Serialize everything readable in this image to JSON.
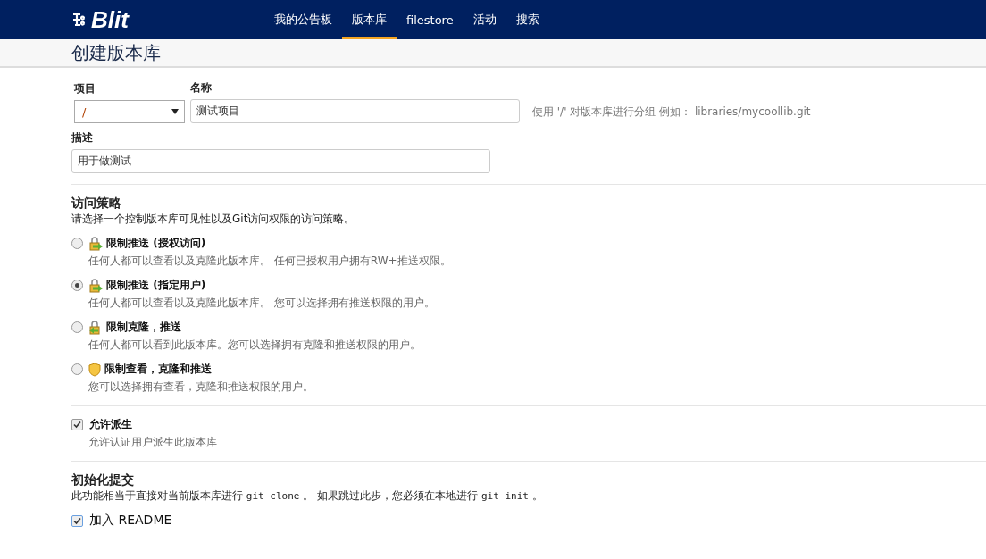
{
  "nav": {
    "logo": "Blit",
    "items": [
      {
        "label": "我的公告板",
        "selected": false
      },
      {
        "label": "版本库",
        "selected": true
      },
      {
        "label": "filestore",
        "selected": false
      },
      {
        "label": "活动",
        "selected": false
      },
      {
        "label": "搜索",
        "selected": false
      }
    ]
  },
  "page_title": "创建版本库",
  "form": {
    "project": {
      "label": "项目",
      "value": "/"
    },
    "name": {
      "label": "名称",
      "value": "测试项目"
    },
    "name_help": "使用 '/' 对版本库进行分组 例如： libraries/mycoollib.git",
    "description": {
      "label": "描述",
      "value": "用于做测试"
    }
  },
  "access": {
    "title": "访问策略",
    "description": "请选择一个控制版本库可见性以及Git访问权限的访问策略。",
    "options": [
      {
        "kind": "lock-push",
        "title": "限制推送 (授权访问)",
        "description": "任何人都可以查看以及克隆此版本库。 任何已授权用户拥有RW+推送权限。",
        "selected": false
      },
      {
        "kind": "lock-push",
        "title": "限制推送 (指定用户)",
        "description": "任何人都可以查看以及克隆此版本库。 您可以选择拥有推送权限的用户。",
        "selected": true
      },
      {
        "kind": "lock-clone",
        "title": "限制克隆，推送",
        "description": "任何人都可以看到此版本库。您可以选择拥有克隆和推送权限的用户。",
        "selected": false
      },
      {
        "kind": "shield",
        "title": "限制查看，克隆和推送",
        "description": "您可以选择拥有查看，克隆和推送权限的用户。",
        "selected": false
      }
    ]
  },
  "fork": {
    "label": "允许派生",
    "description": "允许认证用户派生此版本库",
    "checked": true
  },
  "init": {
    "title": "初始化提交",
    "description": [
      {
        "kind": "text",
        "text": "此功能相当于直接对当前版本库进行 "
      },
      {
        "kind": "code",
        "text": "git clone"
      },
      {
        "kind": "text",
        "text": " 。 如果跳过此步，您必须在本地进行 "
      },
      {
        "kind": "code",
        "text": "git init"
      },
      {
        "kind": "text",
        "text": " 。"
      }
    ],
    "options": [
      {
        "label": "加入 README",
        "checked": true
      }
    ]
  }
}
